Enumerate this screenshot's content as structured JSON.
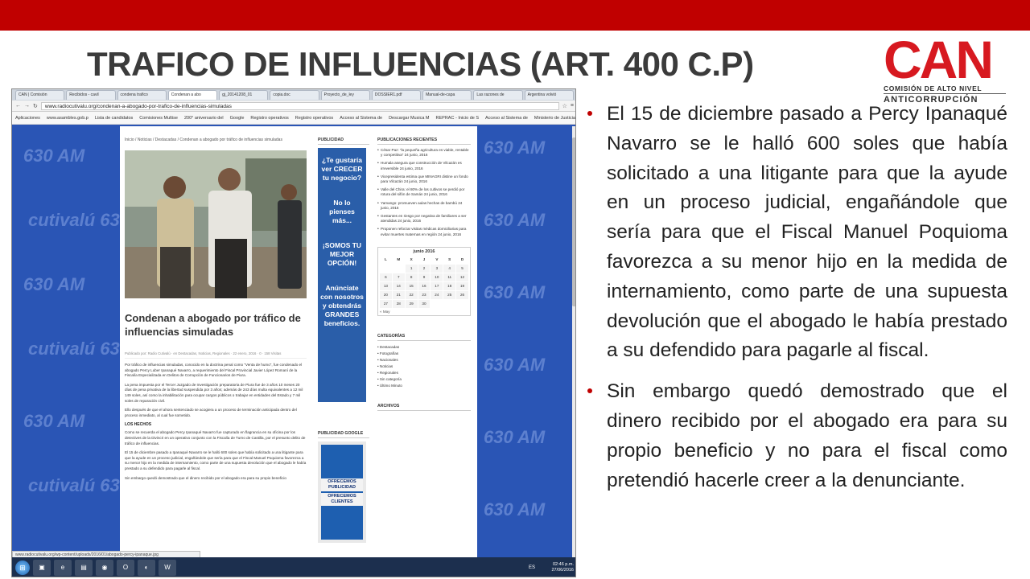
{
  "slide": {
    "title": "TRAFICO DE INFLUENCIAS (ART. 400 C.P)",
    "accent_color": "#c00000",
    "logo": {
      "word": "CAN",
      "line1": "COMISIÓN DE ALTO NIVEL",
      "line2": "ANTICORRUPCIÓN",
      "color": "#d71920"
    },
    "bullets": [
      "El 15 de diciembre pasado a Percy Ipanaqué Navarro se le halló 600 soles que había solicitado a una litigante para que la ayude en un proceso judicial, engañándole que sería para que el Fiscal Manuel Poquioma favorezca a su menor hijo en la medida de internamiento, como parte de una supuesta devolución que el abogado le había prestado a su defendido para pagarle al fiscal.",
      "Sin embargo quedó demostrado que el dinero recibido por el abogado era para su propio beneficio y no para el fiscal como pretendió hacerle creer a la denunciante."
    ]
  },
  "screenshot": {
    "tabs": [
      "CAN | Comisión",
      "Recibidos - cavil",
      "condena trafico",
      "Condenan a abo",
      "gj_20141208_01",
      "copia.doc",
      "Proyecto_de_ley",
      "DOSSIER1.pdf",
      "Manual-de-capa",
      "Las razones de",
      "Argentina volvió"
    ],
    "url": "www.radiocutivalu.org/condenan-a-abogado-por-trafico-de-influencias-simuladas",
    "bookmarks": [
      "Aplicaciones",
      "www.asambles.gob.p",
      "Lista de candidatos",
      "Comisiones Multise",
      "200° aniversario del",
      "Google",
      "Registro operativos",
      "Registro operativos",
      "Acceso al Sistema de",
      "Descargar Musica M",
      "REPRAC - Inicio de S",
      "Acceso al Sistema de",
      "Ministerio de Justicia"
    ],
    "watermark": "cutivalú 630 AM",
    "watermark_short": "630 AM",
    "breadcrumb": "Inicio / Noticias / Destacadas / Condenan a abogado por tráfico de influencias simuladas",
    "article_title": "Condenan a abogado por tráfico de influencias simuladas",
    "article_meta": "Publicado por: Radio Cutivalú · en Destacadas, Noticias, Regionales · 22 enero, 2016 · 0 · 158 Visitas",
    "article_paragraphs": [
      "Por tráfico de influencias simuladas, conocido en la doctrina penal como “Venta de humo”, fue condenado el abogado Percy Luber Ipanaqué Navarro, a requerimiento del Fiscal Provincial Javier López Romaní de la Fiscalía Especializada en Delitos de Corrupción de Funcionarios de Piura.",
      "La pena impuesta por el Tercer Juzgado de Investigación preparatoria de Piura fue de 3 años 10 meses 20 días de pena privativa de la libertad suspendida por 3 años; además de 243 días multa equivalentes a 12 mil 149 soles, así como la inhabilitación para ocupar cargos públicos o trabajar en entidades del Estado y 7 mil soles de reparación civil.",
      "Ello después de que el ahora sentenciado se acogiera a un proceso de terminación anticipada dentro del proceso inmediato, al cual fue sometido."
    ],
    "article_subhead": "LOS HECHOS",
    "article_paragraphs_2": [
      "Como se recuerda el abogado Percy Ipanaqué Navarro fue capturado en flagrancia en su oficina por los detectives de la Divincri en un operativo conjunto con la Fiscalía de Turno de Castilla, por el presunto delito de tráfico de influencias.",
      "El 15 de diciembre pasado a Ipanaqué Navarro se le halló 600 soles que había solicitado a una litigante para que la ayude en un proceso judicial, engañándole que sería para que el Fiscal Manuel Poquioma favorezca a su menor hijo en la medida de internamiento, como parte de una supuesta devolución que el abogado le había prestado a su defendido para pagarle al fiscal.",
      "Sin embargo quedó demostrado que el dinero recibido por el abogado era para su propio beneficio"
    ],
    "publicidad_heading": "PUBLICIDAD",
    "ad1_lines": [
      "¿Te gustaría ver CRECER tu negocio?",
      "No lo pienses más...",
      "¡SOMOS TU MEJOR OPCIÓN!",
      "Anúnciate con nosotros y obtendrás GRANDES beneficios."
    ],
    "publicidad_google_heading": "PUBLICIDAD GOOGLE",
    "ad2_lines": [
      "OFRECEMOS PUBLICIDAD",
      "OFRECEMOS CLIENTES"
    ],
    "recent_heading": "PUBLICACIONES RECIENTES",
    "recent_posts": [
      "César Paz: “la pequeña agricultura es viable, rentable y competitiva” 24 junio, 2016",
      "Humala asegura que construcción de Vilcazán es irreversible 24 junio, 2016",
      "Vicepresidenta estima que MINAGRI distine un fondo para Vilcazán 24 junio, 2016",
      "Valle del Chira: el 80% de los cultivos se perdió por rotura del sifón de Samán 24 junio, 2016",
      "Yamango: promueven aulas hechas de bambú 24 junio, 2016",
      "Gestantes en riesgo por negativa de familiares a ser atendidas 24 junio, 2016",
      "Proponen reforzar visitas médicas domiciliarias para evitar muertes maternas en región 24 junio, 2016"
    ],
    "calendar": {
      "title": "junio 2016",
      "headers": [
        "L",
        "M",
        "X",
        "J",
        "V",
        "S",
        "D"
      ],
      "leading_blanks": 2,
      "days": 30,
      "prev": "« May"
    },
    "categories_heading": "CATEGORÍAS",
    "categories": [
      "Destacadas",
      "Fotografías",
      "Nacionales",
      "Noticias",
      "Regionales",
      "Sin categoría",
      "Último Minuto"
    ],
    "archives_heading": "ARCHIVOS",
    "status_url": "www.radiocutivalu.org/wp-content/uploads/2016/01/abogado-percy-ipanaque.jpg",
    "taskbar_lang": "ES",
    "clock_time": "02:46 p.m.",
    "clock_date": "27/06/2016"
  }
}
